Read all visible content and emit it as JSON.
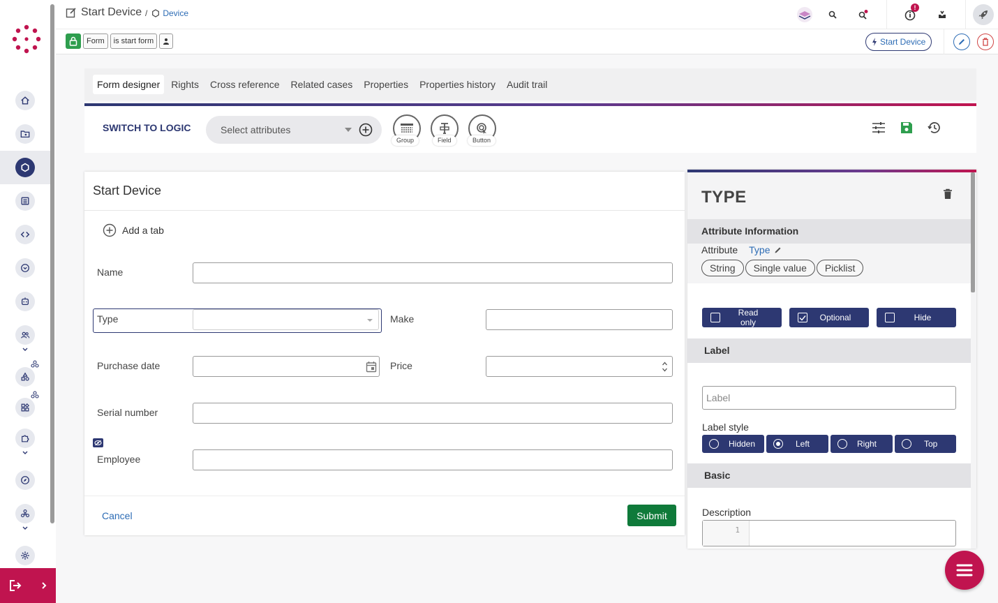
{
  "header": {
    "title": "Start Device",
    "breadcrumb": "Device",
    "tags": [
      "Form",
      "is start form"
    ],
    "start_button": "Start Device",
    "notification_count": "!"
  },
  "tabs": [
    "Form designer",
    "Rights",
    "Cross reference",
    "Related cases",
    "Properties",
    "Properties history",
    "Audit trail"
  ],
  "toolbar": {
    "switch_logic": "SWITCH TO LOGIC",
    "select_placeholder": "Select attributes",
    "tools": [
      "Group",
      "Field",
      "Button"
    ]
  },
  "form": {
    "title": "Start Device",
    "add_tab": "Add a tab",
    "fields": {
      "name": "Name",
      "type": "Type",
      "make": "Make",
      "purchase_date": "Purchase date",
      "price": "Price",
      "serial_number": "Serial number",
      "employee": "Employee"
    },
    "cancel": "Cancel",
    "submit": "Submit"
  },
  "panel": {
    "title": "TYPE",
    "attribute_info_heading": "Attribute Information",
    "attribute_label": "Attribute",
    "attribute_value": "Type",
    "chips": [
      "String",
      "Single value",
      "Picklist"
    ],
    "toggles": [
      {
        "label": "Read only",
        "checked": false
      },
      {
        "label": "Optional",
        "checked": true
      },
      {
        "label": "Hide",
        "checked": false
      }
    ],
    "label_heading": "Label",
    "label_placeholder": "Label",
    "label_style_heading": "Label style",
    "label_styles": [
      {
        "label": "Hidden",
        "selected": false
      },
      {
        "label": "Left",
        "selected": true
      },
      {
        "label": "Right",
        "selected": false
      },
      {
        "label": "Top",
        "selected": false
      }
    ],
    "basic_heading": "Basic",
    "description_label": "Description",
    "description_line": "1"
  },
  "colors": {
    "primary": "#2d3872",
    "accent": "#c0144f",
    "link": "#2d6cb5",
    "success": "#0f7a3a"
  }
}
